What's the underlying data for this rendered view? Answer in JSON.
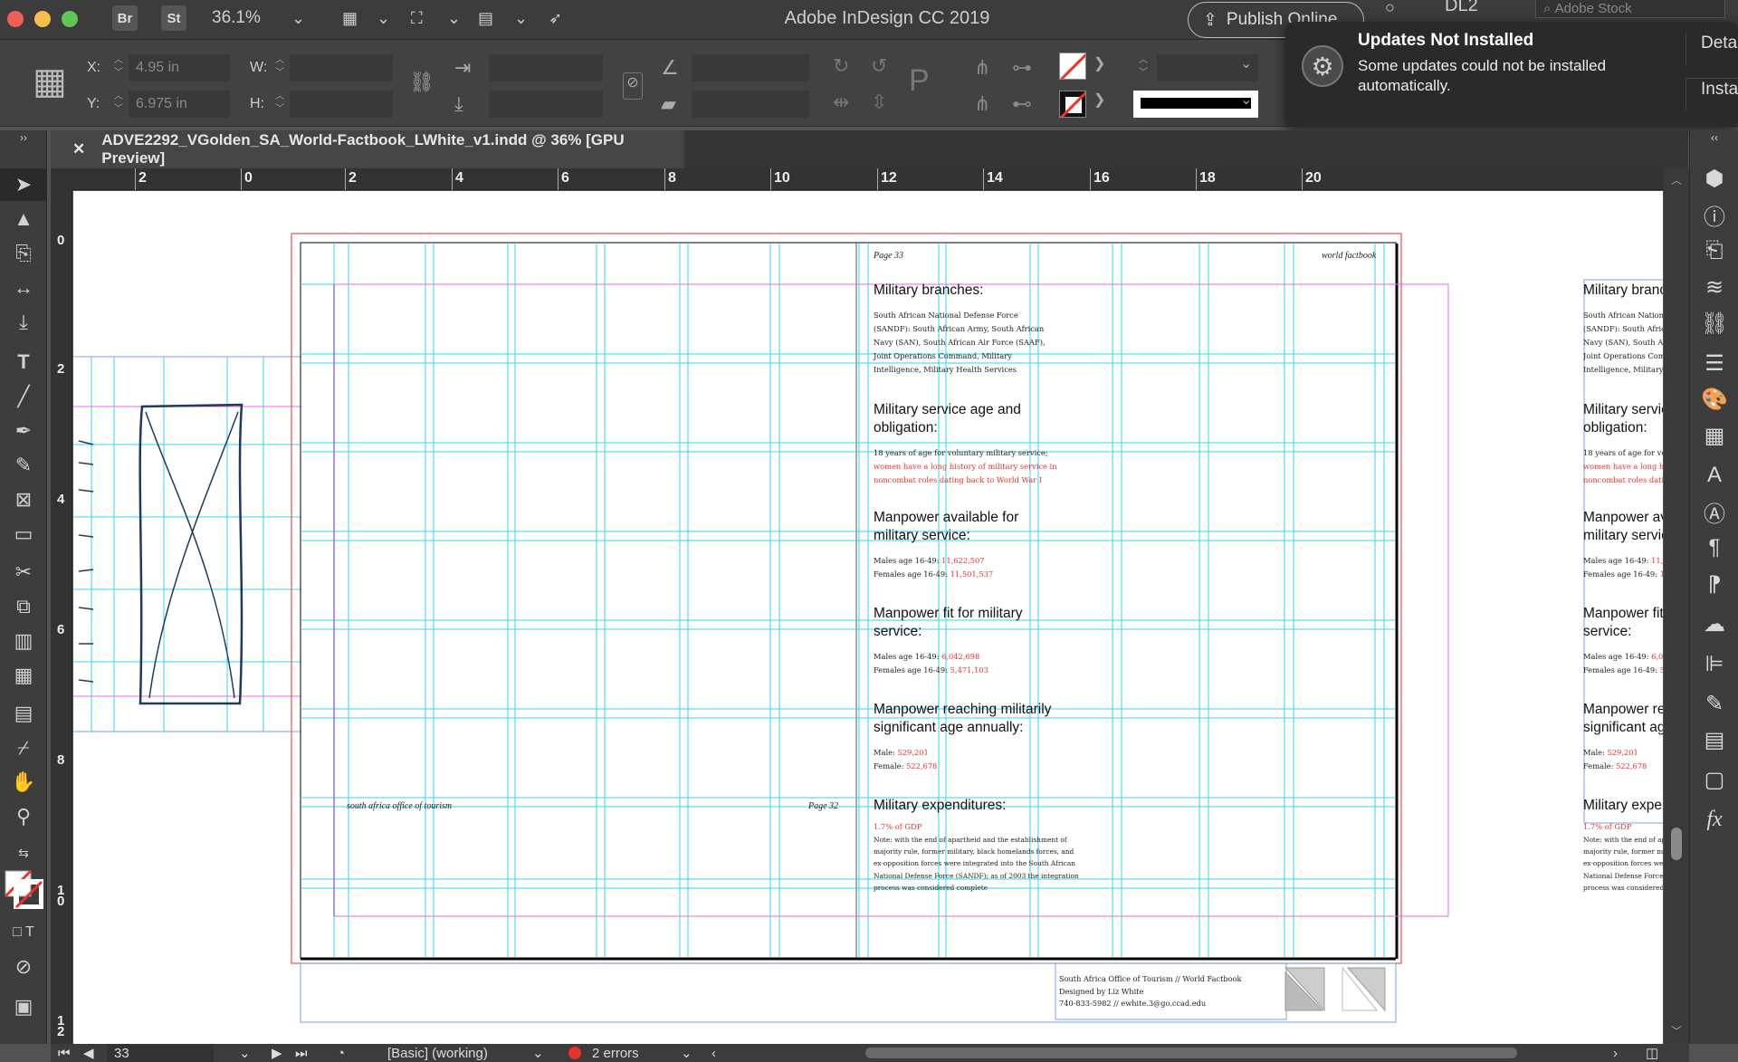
{
  "app": {
    "title": "Adobe InDesign CC 2019",
    "bridge_badge": "Br",
    "stock_badge": "St",
    "zoom": "36.1%",
    "publish_label": "Publish Online",
    "workspace": "DL2",
    "stock_search_placeholder": "Adobe Stock"
  },
  "control": {
    "x_label": "X:",
    "x_value": "4.95 in",
    "y_label": "Y:",
    "y_value": "6.975 in",
    "w_label": "W:",
    "h_label": "H:"
  },
  "notification": {
    "title": "Updates Not Installed",
    "body": "Some updates could not be installed automatically.",
    "action1": "Details",
    "action2": "Install"
  },
  "document": {
    "tab_title": "ADVE2292_VGolden_SA_World-Factbook_LWhite_v1.indd @ 36% [GPU Preview]",
    "hruler": [
      "2",
      "0",
      "2",
      "4",
      "6",
      "8",
      "10",
      "12",
      "14",
      "16",
      "18",
      "20"
    ],
    "vruler": [
      "0",
      "2",
      "4",
      "6",
      "8",
      "1\n0",
      "1\n2"
    ]
  },
  "page": {
    "folio_right": "Page 33",
    "running_head": "world factbook",
    "folio_left_footer": "south africa office of tourism",
    "folio_left_page": "Page 32",
    "sections": [
      {
        "head": "Military branches:",
        "lines": [
          "South African National Defense Force",
          "(SANDF): South African Army, South African",
          "Navy (SAN), South African Air Force (SAAF),",
          "Joint Operations Command, Military",
          "Intelligence, Military Health Services"
        ]
      },
      {
        "head": "Military service age and obligation:",
        "lines": [
          "18 years of age for voluntary military service;",
          "women have a long history of military service in",
          "noncombat roles dating back to World War I"
        ]
      },
      {
        "head": "Manpower available for military service:",
        "lines": [
          "Males age 16-49: 11,622,507",
          "Females age 16-49: 11,501,537"
        ]
      },
      {
        "head": "Manpower fit for military service:",
        "lines": [
          "Males age 16-49: 6,042,698",
          "Females age 16-49: 5,471,103"
        ]
      },
      {
        "head": "Manpower reaching militarily significant age annually:",
        "lines": [
          "Male: 529,201",
          "Female: 522,678"
        ]
      },
      {
        "head": "Military expenditures:",
        "lines": [
          "1.7% of GDP",
          "Note: with the end of apartheid and the establishment of",
          "majority rule, former military, black homelands forces, and",
          "ex-opposition forces were integrated into the South African",
          "National Defense Force (SANDF); as of 2003 the integration",
          "process was considered complete"
        ]
      }
    ],
    "slug": [
      "South Africa Office of Tourism // World Factbook",
      "Designed by Liz White",
      "740-833-5982 // ewhite.3@go.ccad.edu"
    ]
  },
  "status": {
    "page_number": "33",
    "style": "[Basic] (working)",
    "errors": "2 errors"
  },
  "colors": {
    "guide_cyan": "#33d6ee",
    "margin_magenta": "#e86ae8",
    "bleed_red": "#ee4a5a",
    "column_purple": "#8f6ee8",
    "text_red": "#e3332e"
  }
}
